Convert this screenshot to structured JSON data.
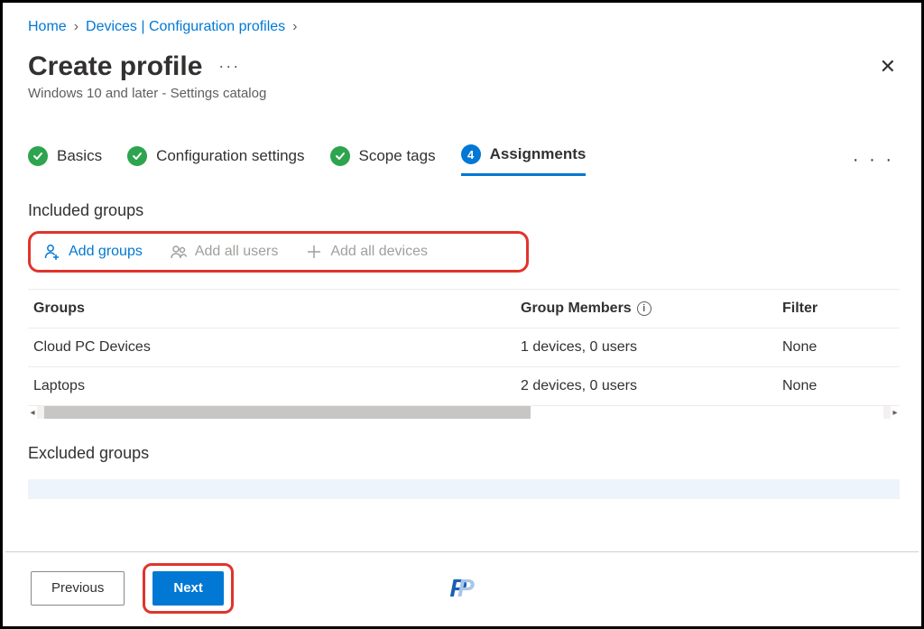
{
  "breadcrumb": {
    "home": "Home",
    "devices": "Devices | Configuration profiles"
  },
  "header": {
    "title": "Create profile",
    "subtitle": "Windows 10 and later - Settings catalog",
    "more": "···",
    "close": "✕"
  },
  "stepper": {
    "steps": [
      {
        "label": "Basics"
      },
      {
        "label": "Configuration settings"
      },
      {
        "label": "Scope tags"
      },
      {
        "label": "Assignments",
        "num": "4"
      }
    ],
    "more": "· · ·"
  },
  "included": {
    "heading": "Included groups",
    "toolbar": {
      "add_groups": "Add groups",
      "add_all_users": "Add all users",
      "add_all_devices": "Add all devices"
    },
    "columns": {
      "groups": "Groups",
      "members": "Group Members",
      "filter": "Filter"
    },
    "rows": [
      {
        "name": "Cloud PC Devices",
        "members": "1 devices, 0 users",
        "filter": "None"
      },
      {
        "name": "Laptops",
        "members": "2 devices, 0 users",
        "filter": "None"
      }
    ]
  },
  "excluded": {
    "heading": "Excluded groups"
  },
  "footer": {
    "previous": "Previous",
    "next": "Next"
  },
  "logo": {
    "text": "P"
  }
}
